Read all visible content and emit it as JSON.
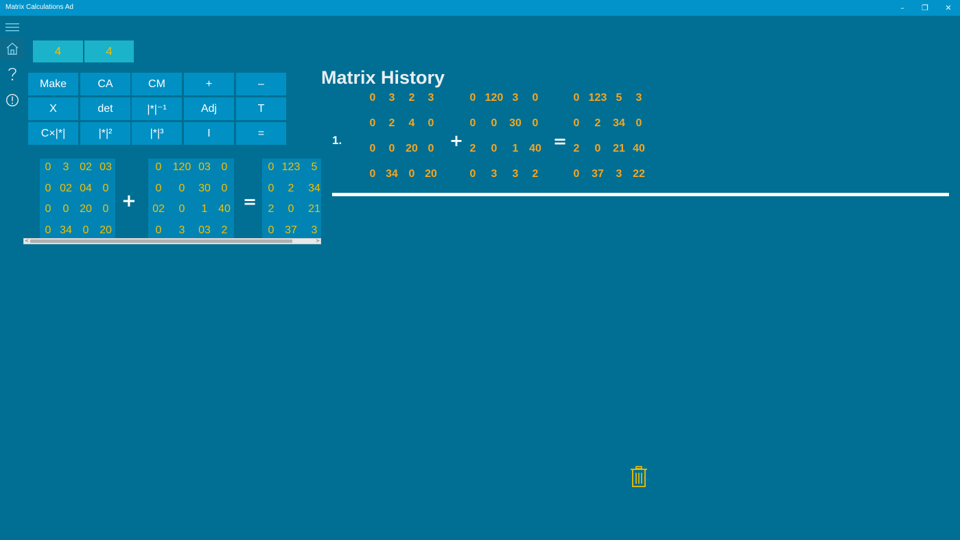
{
  "window": {
    "title": "Matrix Calculations Ad",
    "minimize_glyph": "–",
    "restore_glyph": "❐",
    "close_glyph": "✕"
  },
  "nav": {
    "items": [
      {
        "name": "hamburger-menu-icon",
        "active": false
      },
      {
        "name": "home-icon",
        "active": true
      },
      {
        "name": "help-icon",
        "active": false
      },
      {
        "name": "info-icon",
        "active": false
      }
    ]
  },
  "dimensions": {
    "rows": "4",
    "cols": "4"
  },
  "buttons": [
    [
      "Make",
      "CA",
      "CM",
      "+",
      "–"
    ],
    [
      "X",
      "det",
      "|*|⁻¹",
      "Adj",
      "T"
    ],
    [
      "C×|*|",
      "|*|²",
      "|*|³",
      "I",
      "="
    ]
  ],
  "workspace": {
    "matrix_a": [
      [
        "0",
        "3",
        "02",
        "03"
      ],
      [
        "0",
        "02",
        "04",
        "0"
      ],
      [
        "0",
        "0",
        "20",
        "0"
      ],
      [
        "0",
        "34",
        "0",
        "20"
      ]
    ],
    "operator": "+",
    "matrix_b": [
      [
        "0",
        "120",
        "03",
        "0"
      ],
      [
        "0",
        "0",
        "30",
        "0"
      ],
      [
        "02",
        "0",
        "1",
        "40"
      ],
      [
        "0",
        "3",
        "03",
        "2"
      ]
    ],
    "equals": "=",
    "matrix_result": [
      [
        "0",
        "123",
        "5"
      ],
      [
        "0",
        "2",
        "34"
      ],
      [
        "2",
        "0",
        "21"
      ],
      [
        "0",
        "37",
        "3"
      ]
    ]
  },
  "history": {
    "title": "Matrix History",
    "entries": [
      {
        "index": "1.",
        "matrix_a": [
          [
            "0",
            "3",
            "2",
            "3"
          ],
          [
            "0",
            "2",
            "4",
            "0"
          ],
          [
            "0",
            "0",
            "20",
            "0"
          ],
          [
            "0",
            "34",
            "0",
            "20"
          ]
        ],
        "operator": "+",
        "matrix_b": [
          [
            "0",
            "120",
            "3",
            "0"
          ],
          [
            "0",
            "0",
            "30",
            "0"
          ],
          [
            "2",
            "0",
            "1",
            "40"
          ],
          [
            "0",
            "3",
            "3",
            "2"
          ]
        ],
        "equals": "=",
        "matrix_result": [
          [
            "0",
            "123",
            "5",
            "3"
          ],
          [
            "0",
            "2",
            "34",
            "0"
          ],
          [
            "2",
            "0",
            "21",
            "40"
          ],
          [
            "0",
            "37",
            "3",
            "22"
          ]
        ]
      }
    ]
  },
  "colors": {
    "background": "#006f93",
    "titlebar": "#0193c9",
    "button": "#0190c4",
    "accent_yellow": "#f5c000",
    "history_orange": "#f5a623"
  }
}
